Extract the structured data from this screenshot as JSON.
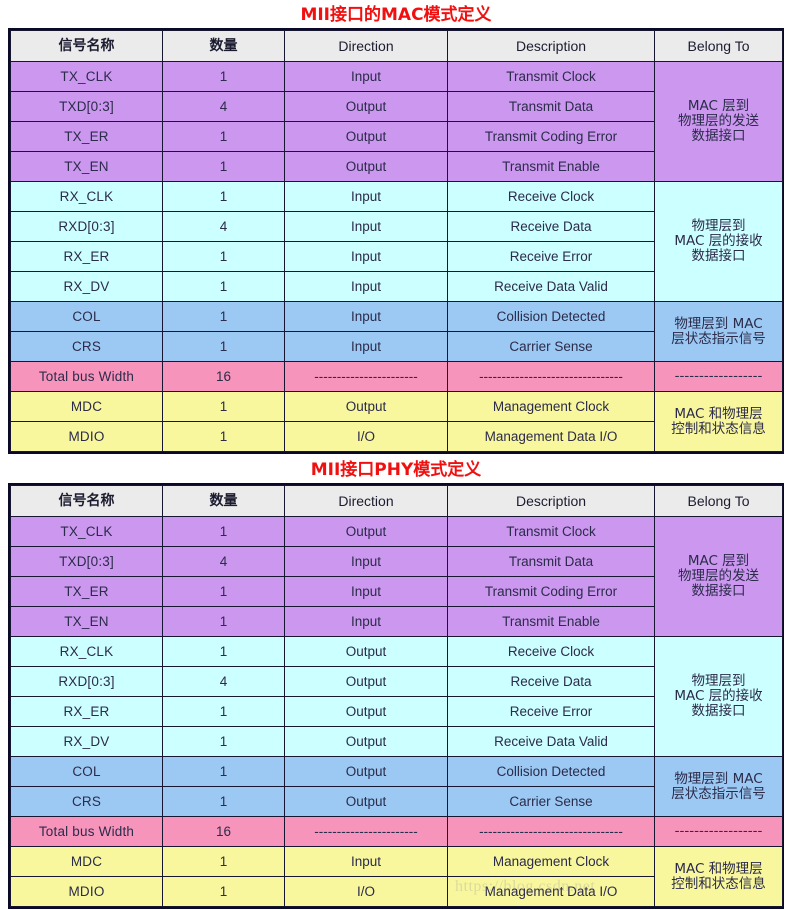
{
  "colors": {
    "title_red": "#f01010",
    "purple": "#cb97ef",
    "cyan": "#ccffff",
    "blue": "#9cc9f3",
    "pink": "#f794bb",
    "yellow": "#f8f79d",
    "header_gray": "#ebebeb",
    "output_red": "#e83a2a",
    "output_amber": "#c07a12"
  },
  "columns": [
    "信号名称",
    "数量",
    "Direction",
    "Description",
    "Belong To"
  ],
  "dashes_long": "-----------------------",
  "dashes_longer": "--------------------------------",
  "dashes_short": "------------------",
  "watermark": "https://blog.csdn.net",
  "tables": [
    {
      "title": "MII接口的MAC模式定义",
      "rows": [
        {
          "name": "TX_CLK",
          "qty": "1",
          "dir": "Input",
          "dir_style": "normal",
          "desc": "Transmit Clock",
          "bg": "purple"
        },
        {
          "name": "TXD[0:3]",
          "qty": "4",
          "dir": "Output",
          "dir_style": "red",
          "desc": "Transmit Data",
          "bg": "purple"
        },
        {
          "name": "TX_ER",
          "qty": "1",
          "dir": "Output",
          "dir_style": "red",
          "desc": "Transmit Coding Error",
          "bg": "purple"
        },
        {
          "name": "TX_EN",
          "qty": "1",
          "dir": "Output",
          "dir_style": "red",
          "desc": "Transmit Enable",
          "bg": "purple"
        },
        {
          "name": "RX_CLK",
          "qty": "1",
          "dir": "Input",
          "dir_style": "normal",
          "desc": "Receive Clock",
          "bg": "cyan"
        },
        {
          "name": "RXD[0:3]",
          "qty": "4",
          "dir": "Input",
          "dir_style": "normal",
          "desc": "Receive Data",
          "bg": "cyan"
        },
        {
          "name": "RX_ER",
          "qty": "1",
          "dir": "Input",
          "dir_style": "normal",
          "desc": "Receive Error",
          "bg": "cyan"
        },
        {
          "name": "RX_DV",
          "qty": "1",
          "dir": "Input",
          "dir_style": "normal",
          "desc": "Receive Data Valid",
          "bg": "cyan"
        },
        {
          "name": "COL",
          "qty": "1",
          "dir": "Input",
          "dir_style": "normal",
          "desc": "Collision Detected",
          "bg": "blue"
        },
        {
          "name": "CRS",
          "qty": "1",
          "dir": "Input",
          "dir_style": "normal",
          "desc": "Carrier Sense",
          "bg": "blue"
        },
        {
          "name": "Total bus Width",
          "qty": "16",
          "dir": "DASH",
          "dir_style": "normal",
          "desc": "DASH",
          "bg": "pink"
        },
        {
          "name": "MDC",
          "qty": "1",
          "dir": "Output",
          "dir_style": "amber",
          "desc": "Management Clock",
          "bg": "yellow"
        },
        {
          "name": "MDIO",
          "qty": "1",
          "dir": "I/O",
          "dir_style": "normal",
          "desc": "Management Data I/O",
          "bg": "yellow"
        }
      ],
      "belong_groups": [
        {
          "lines": [
            "MAC 层到",
            "物理层的发送",
            "数据接口"
          ],
          "span": 4,
          "bg": "purple"
        },
        {
          "lines": [
            "物理层到",
            "MAC 层的接收",
            "数据接口"
          ],
          "span": 4,
          "bg": "cyan"
        },
        {
          "lines": [
            "物理层到 MAC",
            "层状态指示信号"
          ],
          "span": 2,
          "bg": "blue"
        },
        {
          "lines": [
            "DASH"
          ],
          "span": 1,
          "bg": "pink"
        },
        {
          "lines": [
            "MAC 和物理层",
            "控制和状态信息"
          ],
          "span": 2,
          "bg": "yellow"
        }
      ]
    },
    {
      "title": "MII接口PHY模式定义",
      "rows": [
        {
          "name": "TX_CLK",
          "qty": "1",
          "dir": "Output",
          "dir_style": "red",
          "desc": "Transmit Clock",
          "bg": "purple"
        },
        {
          "name": "TXD[0:3]",
          "qty": "4",
          "dir": "Input",
          "dir_style": "normal",
          "desc": "Transmit Data",
          "bg": "purple"
        },
        {
          "name": "TX_ER",
          "qty": "1",
          "dir": "Input",
          "dir_style": "normal",
          "desc": "Transmit Coding Error",
          "bg": "purple"
        },
        {
          "name": "TX_EN",
          "qty": "1",
          "dir": "Input",
          "dir_style": "normal",
          "desc": "Transmit Enable",
          "bg": "purple"
        },
        {
          "name": "RX_CLK",
          "qty": "1",
          "dir": "Output",
          "dir_style": "red",
          "desc": "Receive Clock",
          "bg": "cyan"
        },
        {
          "name": "RXD[0:3]",
          "qty": "4",
          "dir": "Output",
          "dir_style": "red",
          "desc": "Receive Data",
          "bg": "cyan"
        },
        {
          "name": "RX_ER",
          "qty": "1",
          "dir": "Output",
          "dir_style": "red",
          "desc": "Receive Error",
          "bg": "cyan"
        },
        {
          "name": "RX_DV",
          "qty": "1",
          "dir": "Output",
          "dir_style": "red",
          "desc": "Receive Data Valid",
          "bg": "cyan"
        },
        {
          "name": "COL",
          "qty": "1",
          "dir": "Output",
          "dir_style": "red",
          "desc": "Collision Detected",
          "bg": "blue"
        },
        {
          "name": "CRS",
          "qty": "1",
          "dir": "Output",
          "dir_style": "red",
          "desc": "Carrier Sense",
          "bg": "blue"
        },
        {
          "name": "Total bus Width",
          "qty": "16",
          "dir": "DASH",
          "dir_style": "normal",
          "desc": "DASH",
          "bg": "pink"
        },
        {
          "name": "MDC",
          "qty": "1",
          "dir": "Input",
          "dir_style": "normal",
          "desc": "Management Clock",
          "bg": "yellow"
        },
        {
          "name": "MDIO",
          "qty": "1",
          "dir": "I/O",
          "dir_style": "normal",
          "desc": "Management Data I/O",
          "bg": "yellow"
        }
      ],
      "belong_groups": [
        {
          "lines": [
            "MAC 层到",
            "物理层的发送",
            "数据接口"
          ],
          "span": 4,
          "bg": "purple"
        },
        {
          "lines": [
            "物理层到",
            "MAC 层的接收",
            "数据接口"
          ],
          "span": 4,
          "bg": "cyan"
        },
        {
          "lines": [
            "物理层到 MAC",
            "层状态指示信号"
          ],
          "span": 2,
          "bg": "blue"
        },
        {
          "lines": [
            "DASH"
          ],
          "span": 1,
          "bg": "pink"
        },
        {
          "lines": [
            "MAC 和物理层",
            "控制和状态信息"
          ],
          "span": 2,
          "bg": "yellow"
        }
      ]
    }
  ]
}
